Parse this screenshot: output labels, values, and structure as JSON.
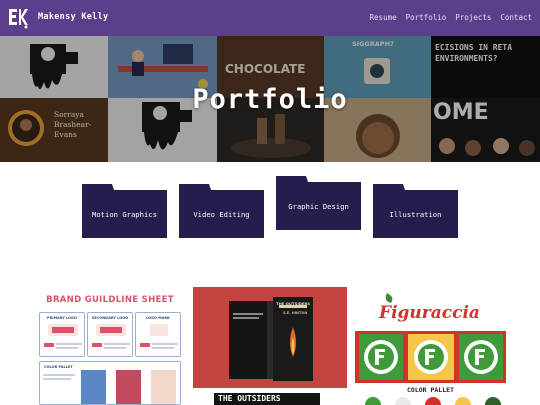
{
  "nav": {
    "brand": "Makensy Kelly",
    "links": [
      "Resume",
      "Portfolio",
      "Projects",
      "Contact"
    ]
  },
  "hero": {
    "title": "Portfolio",
    "tiles": {
      "chocolate": "CHOCOLATE",
      "siggraph": "SIGGRAPH?",
      "decisions": "ECISIONS IN RETA ENVIRONMENTS?",
      "name_first": "Sorraya",
      "name_last1": "Brashear-",
      "name_last2": "Evans",
      "ome": "OME"
    }
  },
  "folders": [
    {
      "label": "Motion Graphics"
    },
    {
      "label": "Video Editing"
    },
    {
      "label": "Graphic Design"
    },
    {
      "label": "Illustration"
    }
  ],
  "cards": {
    "brand_sheet": {
      "title": "BRAND GUILDLINE SHEET",
      "boxes": [
        "PRIMARY LOGO",
        "SECONDARY LOGO",
        "LOGO MARK",
        "COLOR PALLET"
      ]
    },
    "book": {
      "title": "THE OUTSIDERS",
      "author": "S.E. HINTON",
      "strip": "THE OUTSIDERS"
    },
    "figuraccia": {
      "title": "Figuraccia",
      "caption": "COLOR PALLET"
    }
  },
  "colors": {
    "nav": "#5b3f8c",
    "folder": "#241d4e",
    "accent": "#d8546a"
  }
}
